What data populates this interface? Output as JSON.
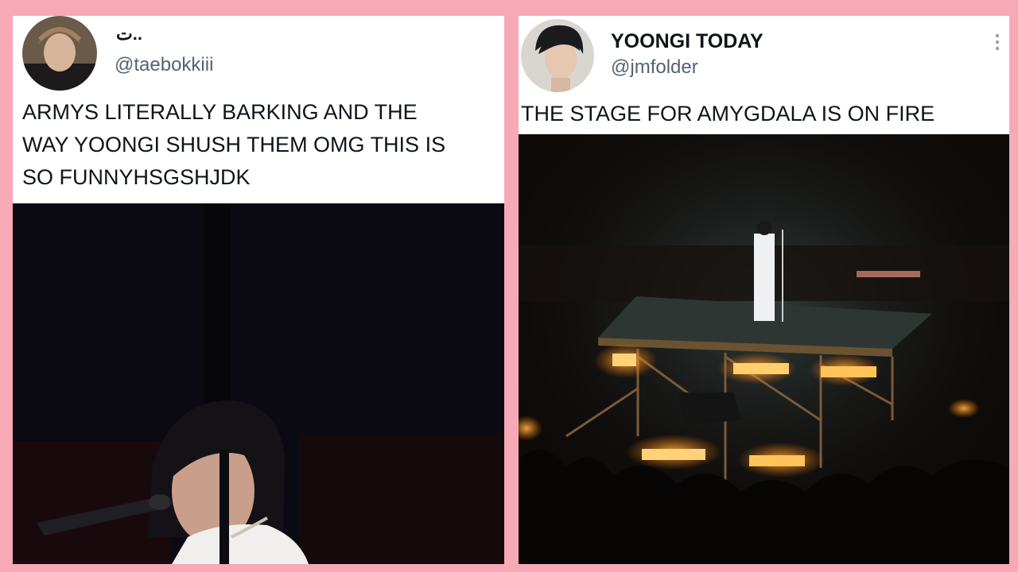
{
  "left_post": {
    "display_name": "ت..",
    "handle": "@taebokkiii",
    "text_lines": [
      "ARMYS LITERALLY BARKING AND THE",
      "WAY YOONGI SHUSH THEM OMG THIS IS",
      "SO FUNNYHSGSHJDK"
    ]
  },
  "right_post": {
    "display_name": "YOONGI TODAY",
    "handle": "@jmfolder",
    "text": "THE STAGE FOR AMYGDALA IS ON FIRE",
    "menu_icon": "more-vertical-icon"
  },
  "colors": {
    "frame_pink": "#f7a9b6",
    "card_white": "#ffffff",
    "handle_gray": "#536471",
    "text_black": "#0f1419"
  }
}
